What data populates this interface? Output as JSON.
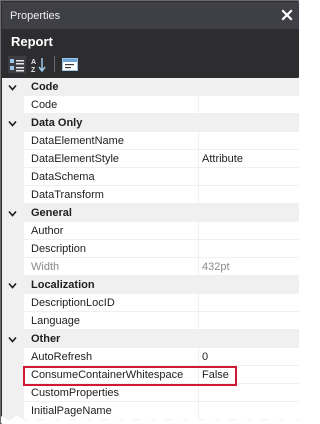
{
  "window": {
    "title": "Properties",
    "close_icon": "close-icon"
  },
  "header": {
    "label": "Report"
  },
  "toolbar": {
    "buttons": [
      {
        "name": "categorized-icon"
      },
      {
        "name": "alphabetical-icon"
      },
      {
        "name": "property-pages-icon"
      }
    ]
  },
  "grid": {
    "categories": {
      "code": "Code",
      "data_only": "Data Only",
      "general": "General",
      "localization": "Localization",
      "other": "Other"
    },
    "properties": {
      "code": {
        "name": "Code",
        "value": ""
      },
      "data_element_name": {
        "name": "DataElementName",
        "value": ""
      },
      "data_element_style": {
        "name": "DataElementStyle",
        "value": "Attribute"
      },
      "data_schema": {
        "name": "DataSchema",
        "value": ""
      },
      "data_transform": {
        "name": "DataTransform",
        "value": ""
      },
      "author": {
        "name": "Author",
        "value": ""
      },
      "description": {
        "name": "Description",
        "value": ""
      },
      "width": {
        "name": "Width",
        "value": "432pt"
      },
      "description_loc_id": {
        "name": "DescriptionLocID",
        "value": ""
      },
      "language": {
        "name": "Language",
        "value": ""
      },
      "auto_refresh": {
        "name": "AutoRefresh",
        "value": "0"
      },
      "consume_container_whitespace": {
        "name": "ConsumeContainerWhitespace",
        "value": "False"
      },
      "custom_properties": {
        "name": "CustomProperties",
        "value": ""
      },
      "initial_page_name": {
        "name": "InitialPageName",
        "value": ""
      }
    }
  },
  "colors": {
    "highlight": "#d01a33",
    "titlebar": "#3f3f46",
    "panel": "#2d2d30"
  }
}
